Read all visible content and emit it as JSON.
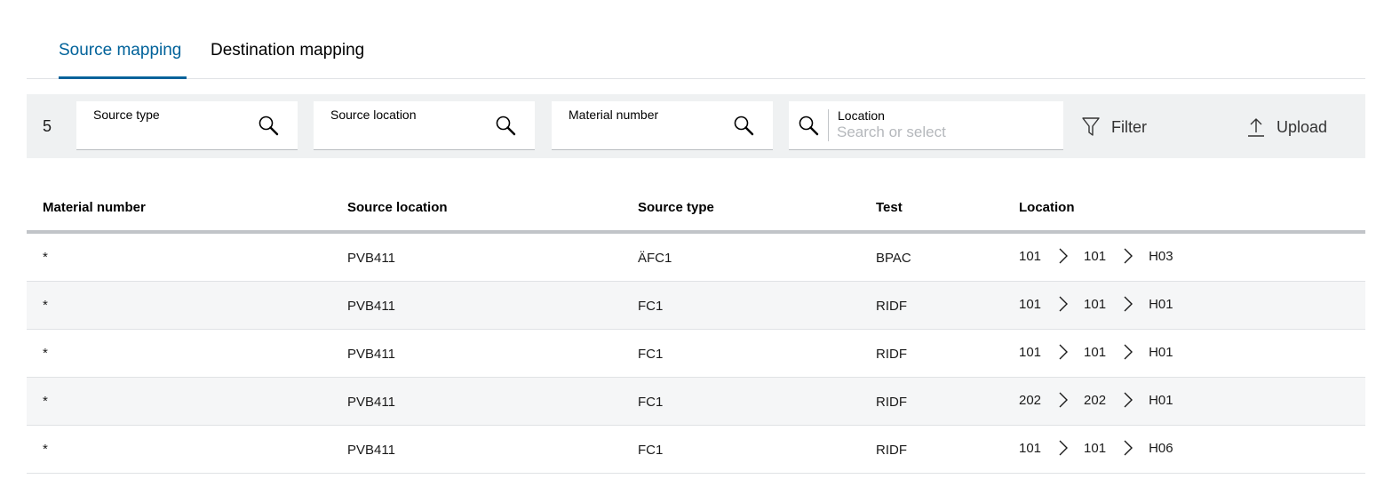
{
  "tabs": [
    {
      "label": "Source mapping",
      "active": true
    },
    {
      "label": "Destination mapping",
      "active": false
    }
  ],
  "toolbar": {
    "count": "5",
    "fields": {
      "source_type": {
        "label": "Source type",
        "icon": "search-icon"
      },
      "source_location": {
        "label": "Source location",
        "icon": "search-icon"
      },
      "material_number": {
        "label": "Material number",
        "icon": "search-icon"
      },
      "location": {
        "label": "Location",
        "placeholder": "Search or select",
        "value": "",
        "icon": "search-icon"
      }
    },
    "filter_label": "Filter",
    "upload_label": "Upload"
  },
  "table": {
    "headers": [
      "Material number",
      "Source location",
      "Source type",
      "Test",
      "Location"
    ],
    "rows": [
      {
        "material": "*",
        "source_location": "PVB411",
        "source_type": "ÄFC1",
        "test": "BPAC",
        "location": [
          "101",
          "101",
          "H03"
        ]
      },
      {
        "material": "*",
        "source_location": "PVB411",
        "source_type": "FC1",
        "test": "RIDF",
        "location": [
          "101",
          "101",
          "H01"
        ]
      },
      {
        "material": "*",
        "source_location": "PVB411",
        "source_type": "FC1",
        "test": "RIDF",
        "location": [
          "101",
          "101",
          "H01"
        ]
      },
      {
        "material": "*",
        "source_location": "PVB411",
        "source_type": "FC1",
        "test": "RIDF",
        "location": [
          "202",
          "202",
          "H01"
        ]
      },
      {
        "material": "*",
        "source_location": "PVB411",
        "source_type": "FC1",
        "test": "RIDF",
        "location": [
          "101",
          "101",
          "H06"
        ]
      }
    ]
  },
  "colors": {
    "accent": "#00629a",
    "toolbar_bg": "#eff1f2",
    "row_alt_bg": "#f5f6f7"
  }
}
